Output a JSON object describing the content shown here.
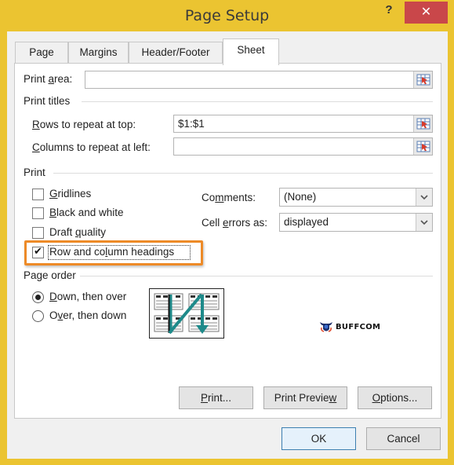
{
  "window": {
    "title": "Page Setup",
    "help_label": "?",
    "close_label": "✕"
  },
  "tabs": [
    {
      "label": "Page",
      "active": false
    },
    {
      "label": "Margins",
      "active": false
    },
    {
      "label": "Header/Footer",
      "active": false
    },
    {
      "label": "Sheet",
      "active": true
    }
  ],
  "sheet": {
    "print_area": {
      "label_pre": "Print ",
      "label_key": "a",
      "label_post": "rea:",
      "value": ""
    },
    "print_titles": {
      "heading": "Print titles",
      "rows": {
        "label_key": "R",
        "label_post": "ows to repeat at top:",
        "value": "$1:$1"
      },
      "columns": {
        "label_key": "C",
        "label_post": "olumns to repeat at left:",
        "value": ""
      }
    },
    "print": {
      "heading": "Print",
      "gridlines": {
        "label_key": "G",
        "label_post": "ridlines",
        "checked": false
      },
      "black_white": {
        "label_key": "B",
        "label_post": "lack and white",
        "checked": false
      },
      "draft": {
        "label_pre": "Draft ",
        "label_key": "q",
        "label_post": "uality",
        "checked": false
      },
      "headings": {
        "label_pre": "Row and co",
        "label_key": "l",
        "label_post": "umn headings",
        "checked": true
      },
      "comments": {
        "label_pre": "Co",
        "label_key": "m",
        "label_post": "ments:",
        "value": "(None)"
      },
      "cell_errors": {
        "label_pre": "Cell ",
        "label_key": "e",
        "label_post": "rrors as:",
        "value": "displayed"
      }
    },
    "page_order": {
      "heading": "Page order",
      "down_then_over": {
        "label_key": "D",
        "label_post": "own, then over",
        "selected": true
      },
      "over_then_down": {
        "label_pre": "O",
        "label_key": "v",
        "label_post": "er, then down",
        "selected": false
      }
    }
  },
  "buttons": {
    "print": {
      "label_key": "P",
      "label_post": "rint..."
    },
    "print_preview": {
      "label_pre": "Print Previe",
      "label_key": "w"
    },
    "options": {
      "label_key": "O",
      "label_post": "ptions..."
    },
    "ok": "OK",
    "cancel": "Cancel"
  },
  "watermark": {
    "text": "BUFFCOM"
  },
  "colors": {
    "title_bar": "#ebc431",
    "close_button": "#c9474a",
    "highlight": "#ed8a27",
    "arrow": "#1e8a8a"
  }
}
